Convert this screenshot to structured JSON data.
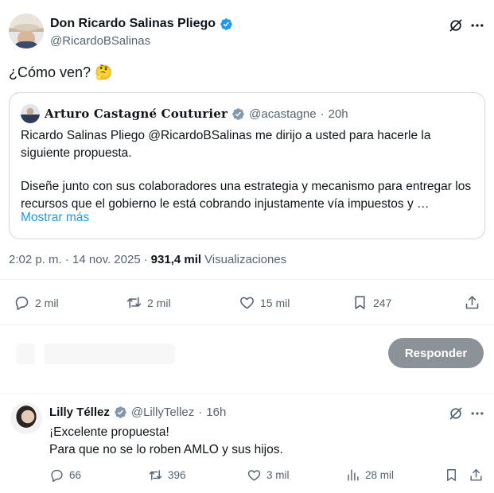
{
  "main_tweet": {
    "author_name": "Don Ricardo Salinas Pliego",
    "author_handle": "@RicardoBSalinas",
    "text": "¿Cómo ven? 🤔",
    "timestamp": "2:02 p. m. · 14 nov. 2025",
    "views_count": "931,4 mil",
    "views_label": "Visualizaciones",
    "stats": {
      "replies": "2 mil",
      "reposts": "2 mil",
      "likes": "15 mil",
      "bookmarks": "247"
    }
  },
  "quoted_tweet": {
    "author_name": "𝐀𝐫𝐭𝐮𝐫𝐨 𝐂𝐚𝐬𝐭𝐚𝐠𝐧𝐞́ 𝐂𝐨𝐮𝐭𝐮𝐫𝐢𝐞𝐫",
    "author_handle": "@acastagne",
    "time_ago": "20h",
    "paragraph_1": "Ricardo Salinas Pliego @RicardoBSalinas me dirijo a usted para hacerle la siguiente propuesta.",
    "paragraph_2": "Diseñe junto con sus colaboradores una estrategia y mecanismo para entregar los recursos que el gobierno le está cobrando injustamente vía impuestos y …",
    "show_more": "Mostrar más"
  },
  "composer": {
    "reply_button": "Responder"
  },
  "reply": {
    "author_name": "Lilly Téllez",
    "author_handle": "@LillyTellez",
    "time_ago": "16h",
    "line_1": "¡Excelente propuesta!",
    "line_2": "Para que no se lo roben AMLO y sus hijos.",
    "stats": {
      "replies": "66",
      "reposts": "396",
      "likes": "3 mil",
      "views": "28 mil"
    }
  },
  "colors": {
    "verified_blue": "#1d9bf0",
    "verified_gray": "#829aab",
    "link_blue": "#1d9bf0",
    "secondary_text": "#536471",
    "reply_button_bg": "#8b9298"
  },
  "icons": [
    "verified-badge-icon",
    "grok-icon",
    "more-icon",
    "reply-icon",
    "repost-icon",
    "like-icon",
    "bookmark-icon",
    "share-icon",
    "views-icon"
  ]
}
